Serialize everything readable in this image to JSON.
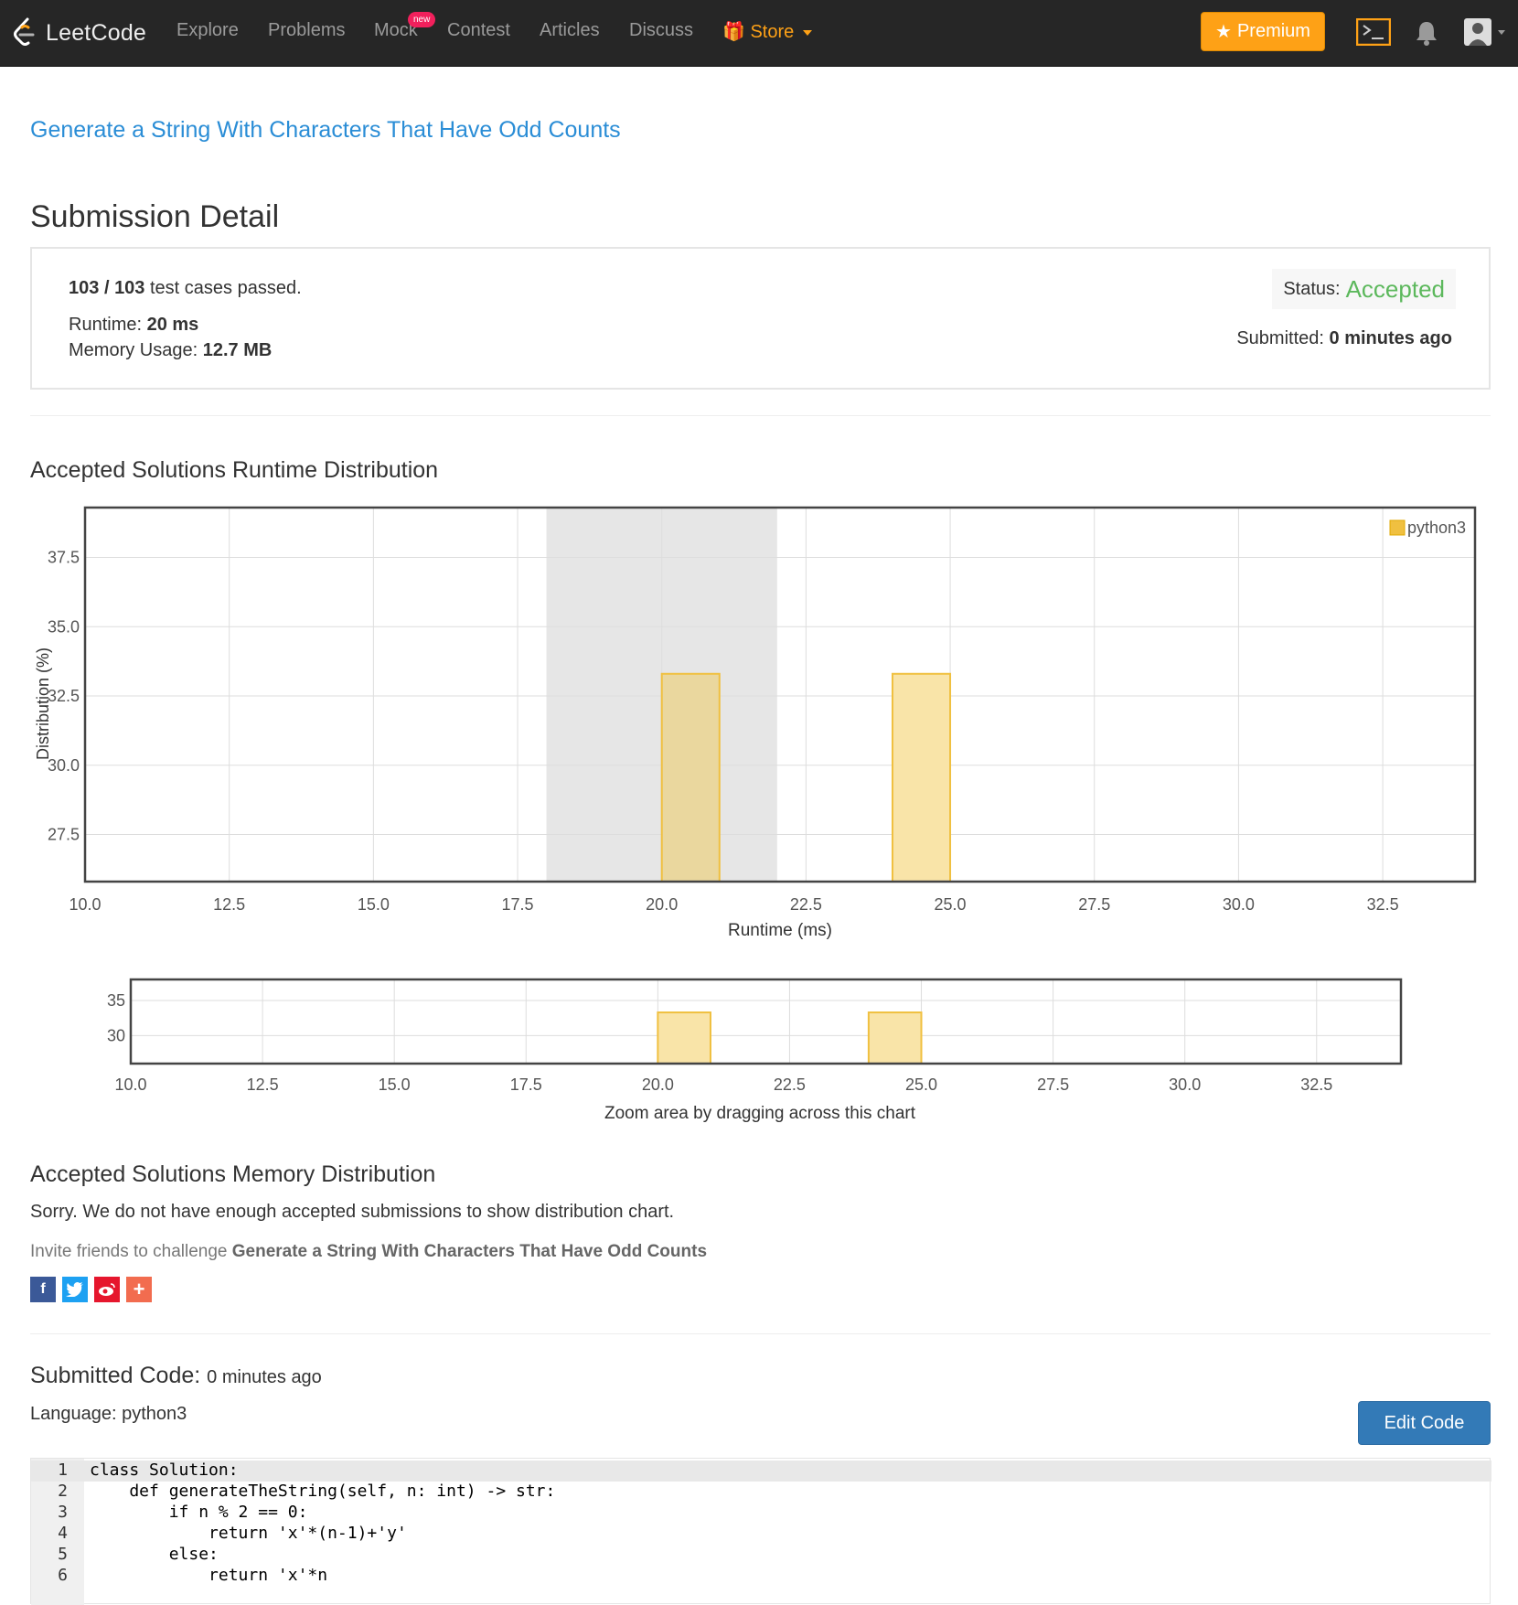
{
  "nav": {
    "logo_text": "LeetCode",
    "items": [
      "Explore",
      "Problems",
      "Mock",
      "Contest",
      "Articles",
      "Discuss"
    ],
    "mock_badge": "new",
    "store_label": "Store",
    "premium_label": "Premium",
    "accent_color": "#fea116"
  },
  "problem_title": "Generate a String With Characters That Have Odd Counts",
  "page_title": "Submission Detail",
  "result": {
    "passed": "103",
    "total": "103",
    "passed_suffix": "test cases passed.",
    "status_label": "Status:",
    "status_value": "Accepted",
    "runtime_label": "Runtime:",
    "runtime_value": "20 ms",
    "memory_label": "Memory Usage:",
    "memory_value": "12.7 MB",
    "submitted_label": "Submitted:",
    "submitted_value": "0 minutes ago"
  },
  "runtime_section_title": "Accepted Solutions Runtime Distribution",
  "chart_data": [
    {
      "type": "bar",
      "series": [
        {
          "name": "python3",
          "x": [
            20.5,
            24.5
          ],
          "values": [
            33.3,
            33.3
          ],
          "color": "#f0c040"
        }
      ],
      "xlabel": "Runtime (ms)",
      "ylabel": "Distribution (%)",
      "xlim": [
        10,
        34.1
      ],
      "ylim": [
        25.8,
        39.3
      ],
      "x_ticks": [
        "10.0",
        "12.5",
        "15.0",
        "17.5",
        "20.0",
        "22.5",
        "25.0",
        "27.5",
        "30.0",
        "32.5"
      ],
      "y_ticks": [
        "27.5",
        "30.0",
        "32.5",
        "35.0",
        "37.5"
      ],
      "highlight_range": [
        18.0,
        22.0
      ],
      "grid": true,
      "legend": "top-right"
    },
    {
      "type": "bar",
      "series": [
        {
          "name": "python3",
          "x": [
            20.5,
            24.5
          ],
          "values": [
            33.3,
            33.3
          ]
        }
      ],
      "xlim": [
        10,
        34.1
      ],
      "ylim": [
        26,
        38
      ],
      "x_ticks": [
        "10.0",
        "12.5",
        "15.0",
        "17.5",
        "20.0",
        "22.5",
        "25.0",
        "27.5",
        "30.0",
        "32.5"
      ],
      "y_ticks": [
        "30",
        "35"
      ],
      "xlabel": "Zoom area by dragging across this chart",
      "grid": true
    }
  ],
  "memory_section_title": "Accepted Solutions Memory Distribution",
  "memory_sorry": "Sorry. We do not have enough accepted submissions to show distribution chart.",
  "invite_prefix": "Invite friends to challenge",
  "invite_problem": "Generate a String With Characters That Have Odd Counts",
  "share_icons": [
    "facebook-icon",
    "twitter-icon",
    "weibo-icon",
    "plus-icon"
  ],
  "code": {
    "heading": "Submitted Code:",
    "time": "0 minutes ago",
    "language_label": "Language:",
    "language": "python3",
    "edit_label": "Edit Code",
    "lines": [
      "class Solution:",
      "    def generateTheString(self, n: int) -> str:",
      "        if n % 2 == 0:",
      "            return 'x'*(n-1)+'y'",
      "        else:",
      "            return 'x'*n"
    ]
  }
}
